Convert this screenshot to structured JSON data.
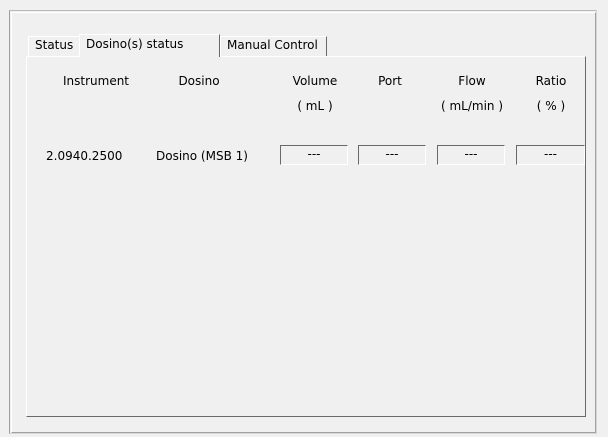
{
  "tabs": [
    {
      "label": "Status",
      "active": false
    },
    {
      "label": "Dosino(s) status",
      "active": true
    },
    {
      "label": "Manual Control",
      "active": false
    }
  ],
  "columns": {
    "instrument": {
      "label": "Instrument"
    },
    "dosino": {
      "label": "Dosino"
    },
    "volume": {
      "label": "Volume",
      "unit": "( mL )"
    },
    "port": {
      "label": "Port"
    },
    "flow": {
      "label": "Flow",
      "unit": "( mL/min )"
    },
    "ratio": {
      "label": "Ratio",
      "unit": "( % )"
    }
  },
  "rows": [
    {
      "instrument": "2.0940.2500",
      "dosino": "Dosino (MSB 1)",
      "volume": "---",
      "port": "---",
      "flow": "---",
      "ratio": "---"
    }
  ]
}
